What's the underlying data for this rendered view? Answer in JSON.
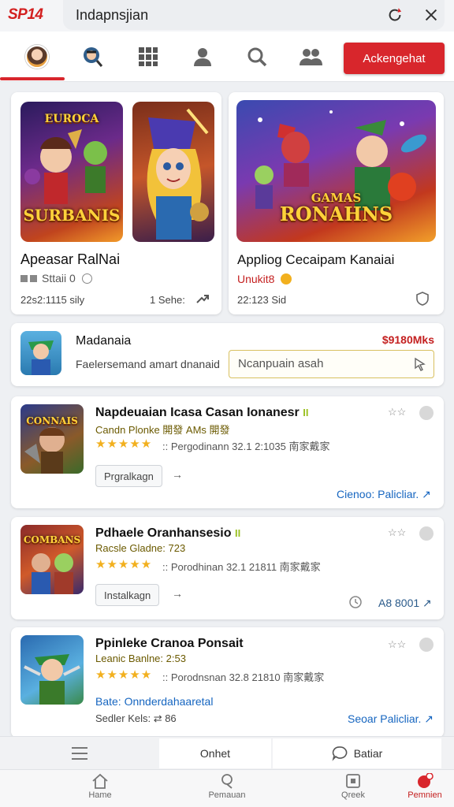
{
  "app": {
    "logo": "SP14"
  },
  "address_bar": {
    "text": "Indapnsjian"
  },
  "nav": {
    "cta_label": "Ackengehat"
  },
  "featured": [
    {
      "art_title": "SURBANIS",
      "art_subtitle": "EUROCA",
      "title": "Apeasar RalNai",
      "meta": "Sttaii 0",
      "stats": "22s2:1115 sily",
      "stats_right": "1 Sehe:"
    },
    {
      "art_title": "RONAHNS",
      "art_subtitle": "GAMAS",
      "title": "Appliog Cecaipam Kanaiai",
      "meta": "Unukit8",
      "stats": "22:123 Sid",
      "stats_right": ""
    }
  ],
  "search_card": {
    "title": "Madanaia",
    "price": "$9180Mks",
    "description": "Faelersemand amart dnanaid",
    "input_value": "Ncanpuain asah"
  },
  "list_items": [
    {
      "art_title": "CONNAIS",
      "title": "Napdeuaian Icasa Casan Ionanesr",
      "badge": "II",
      "sub": "Candn Plonke 開發 AMs 開發",
      "rating": "Pergodinann 32.1 2:1035 南家戴家",
      "button": "Prgralkagn",
      "link": "Cienoo: Palicliar.",
      "right_extra": ""
    },
    {
      "art_title": "COMBANS",
      "title": "Pdhaele Oranhansesio",
      "badge": "II",
      "sub": "Racsle Gladne: 723",
      "rating": "Porodhinan 32.1 21811 南家戴家",
      "button": "Instalkagn",
      "link": "",
      "right_extra": "A8 8001"
    },
    {
      "art_title": "",
      "title": "Ppinleke Cranoa Ponsait",
      "badge": "",
      "sub": "Leanic Banlne: 2:53",
      "rating": "Porodnsnan 32.8 21810 南家戴家",
      "extra_label": "Bate: Onnderdahaaretal",
      "extra_meta": "Sedler Kels: ⇄ 86",
      "link": "Seoar Palicliar."
    }
  ],
  "toolbar": {
    "left": "Onhet",
    "right": "Batiar"
  },
  "bottom_nav": [
    "Hame",
    "Pemauan",
    "Qreek",
    "Pemnien"
  ],
  "colors": {
    "accent": "#d8262c",
    "link": "#1565c0",
    "star": "#f2b01e"
  }
}
